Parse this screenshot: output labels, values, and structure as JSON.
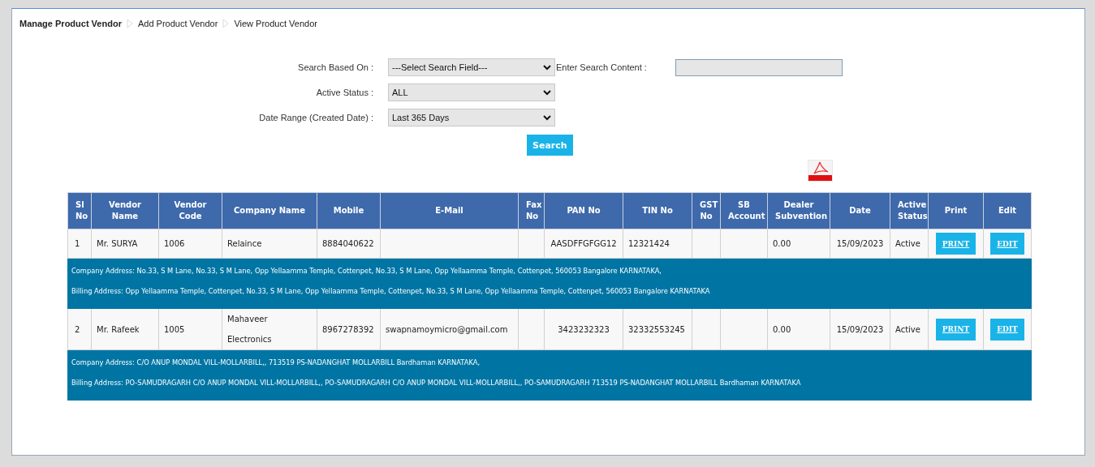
{
  "breadcrumb": [
    "Manage Product Vendor",
    "Add Product Vendor",
    "View Product Vendor"
  ],
  "search_form": {
    "fields": [
      {
        "kind": "dropdown_with_text",
        "label": "Search Based On :",
        "value": "---Select Search Field---",
        "extra_label": "Enter Search Content :"
      },
      {
        "kind": "dropdown",
        "label": "Active Status :",
        "value": "ALL"
      },
      {
        "kind": "dropdown",
        "label": "Date Range (Created Date) :",
        "value": "Last 365 Days"
      }
    ],
    "search_button": "Search"
  },
  "table": {
    "columns": [
      "Sl No",
      "Vendor Name",
      "Vendor Code",
      "Company Name",
      "Mobile",
      "E-Mail",
      "Fax No",
      "PAN No",
      "TIN No",
      "GST No",
      "SB Account",
      "Dealer Subvention",
      "Date",
      "Active Status",
      "Print",
      "Edit"
    ],
    "rows": [
      {
        "cells": [
          "1",
          "Mr. SURYA",
          "1006",
          "Relaince",
          "8884040622",
          "",
          "",
          "AASDFFGFGG12",
          "12321424",
          "",
          "",
          "0.00",
          "15/09/2023",
          "Active"
        ],
        "print": "PRINT",
        "edit": "EDIT",
        "company_address": "Company Address: No.33, S M Lane, No.33, S M Lane, Opp Yellaamma Temple, Cottenpet, No.33, S M Lane, Opp Yellaamma Temple, Cottenpet, 560053 Bangalore KARNATAKA,",
        "billing_address": "Billing Address: Opp Yellaamma Temple, Cottenpet, No.33, S M Lane, Opp Yellaamma Temple, Cottenpet, No.33, S M Lane, Opp Yellaamma Temple, Cottenpet, 560053 Bangalore KARNATAKA"
      },
      {
        "cells": [
          "2",
          "Mr. Rafeek",
          "1005",
          "Mahaveer Electronics",
          "8967278392",
          "swapnamoymicro@gmail.com",
          "",
          "3423232323",
          "32332553245",
          "",
          "",
          "0.00",
          "15/09/2023",
          "Active"
        ],
        "print": "PRINT",
        "edit": "EDIT",
        "company_address": "Company Address: C/O ANUP MONDAL VILL-MOLLARBILL,, 713519 PS-NADANGHAT MOLLARBILL Bardhaman KARNATAKA,",
        "billing_address": "Billing Address: PO-SAMUDRAGARH C/O ANUP MONDAL VILL-MOLLARBILL,, PO-SAMUDRAGARH C/O ANUP MONDAL VILL-MOLLARBILL,, PO-SAMUDRAGARH 713519 PS-NADANGHAT MOLLARBILL Bardhaman KARNATAKA"
      }
    ]
  }
}
